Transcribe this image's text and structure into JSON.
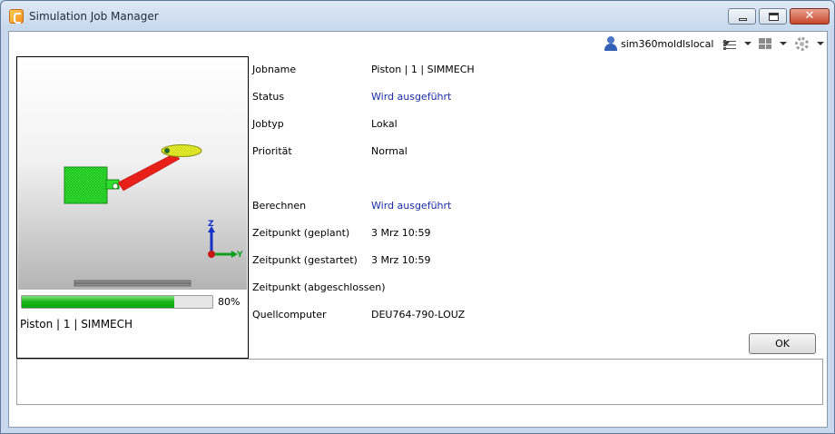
{
  "window": {
    "title": "Simulation Job Manager",
    "caption_buttons": {
      "minimize": "minimize",
      "maximize": "maximize",
      "close": "✕"
    }
  },
  "toolbar": {
    "user": "sim360moldlslocal",
    "icons": [
      "user-icon",
      "list-view-icon",
      "layout-grid-icon",
      "gear-icon"
    ]
  },
  "job_card": {
    "progress_value": 80,
    "progress_label": "80%",
    "caption": "Piston  |  1  |  SIMMECH",
    "axis_labels": {
      "z": "Z",
      "y": "Y"
    },
    "colors": {
      "green_part": "#2ee02e",
      "red_part": "#e8201a",
      "yellow_part": "#e6ee2a"
    }
  },
  "details": [
    {
      "label": "Jobname",
      "value": "Piston | 1 | SIMMECH",
      "link": false
    },
    {
      "label": "Status",
      "value": "Wird ausgeführt",
      "link": true
    },
    {
      "label": "Jobtyp",
      "value": "Lokal",
      "link": false
    },
    {
      "label": "Priorität",
      "value": "Normal",
      "link": false
    },
    {
      "label": "Berechnen",
      "value": "Wird ausgeführt",
      "link": true
    },
    {
      "label": "Zeitpunkt (geplant)",
      "value": "3 Mrz 10:59",
      "link": false
    },
    {
      "label": "Zeitpunkt (gestartet)",
      "value": "3 Mrz 10:59",
      "link": false
    },
    {
      "label": "Zeitpunkt (abgeschlossen)",
      "value": "",
      "link": false
    },
    {
      "label": "Quellcomputer",
      "value": "DEU764-790-LOUZ",
      "link": false
    }
  ],
  "buttons": {
    "ok": "OK"
  },
  "theme": {
    "link_color": "#1a2ea8",
    "progress_color": "#17b417"
  }
}
